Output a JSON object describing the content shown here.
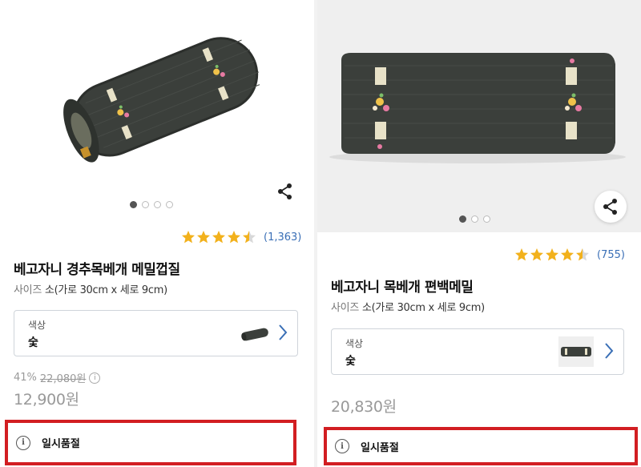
{
  "left": {
    "title": "베고자니 경추목베개 메밀껍질",
    "size_label": "사이즈",
    "size_value": "소(가로 30cm x 세로 9cm)",
    "rating_count": "(1,363)",
    "rating": 4.5,
    "option_label": "색상",
    "option_value": "숯",
    "discount_rate": "41%",
    "original_price": "22,080원",
    "price": "12,900원",
    "soldout_text": "일시품절",
    "carousel_pages": 4,
    "carousel_active": 1
  },
  "right": {
    "title": "베고자니 목베개 편백메밀",
    "size_label": "사이즈",
    "size_value": "소(가로 30cm x 세로 9cm)",
    "rating_count": "(755)",
    "rating": 4.5,
    "option_label": "색상",
    "option_value": "숯",
    "price": "20,830원",
    "soldout_text": "일시품절",
    "carousel_pages": 3,
    "carousel_active": 1
  },
  "colors": {
    "accent_red": "#d21e22",
    "star": "#f2b11c",
    "link_blue": "#3a6fb6",
    "pillow": "#3b3f3b"
  },
  "icons": [
    "share-icon",
    "star-icon",
    "chevron-right-icon",
    "info-icon"
  ]
}
